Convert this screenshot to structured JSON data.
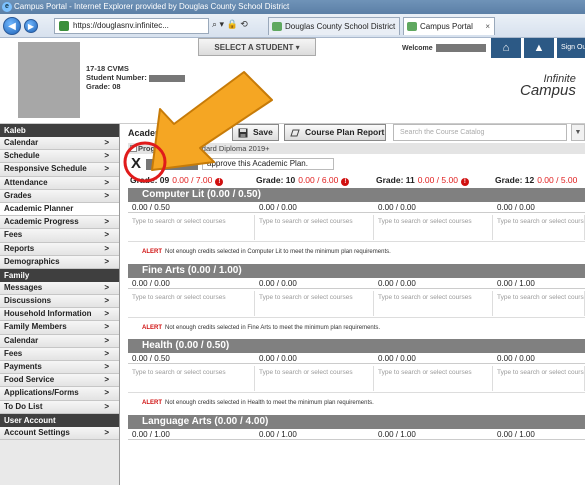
{
  "window": {
    "title": "Campus Portal - Internet Explorer provided by Douglas County School District"
  },
  "browser": {
    "address": "https://douglasnv.infinitec...",
    "address_tools": "⌕ ▾ 🔒 ⟲",
    "tabs": [
      {
        "label": "Douglas County School District"
      },
      {
        "label": "Campus Portal"
      }
    ]
  },
  "header": {
    "select_student": "SELECT A STUDENT  ▾",
    "welcome": "Welcome",
    "signout": "Sign Out",
    "school_year": "17-18 CVMS",
    "student_number_label": "Student Number:",
    "grade_label": "Grade: 08",
    "logo_top": "Infinite",
    "logo_bottom": "Campus"
  },
  "sidebar": {
    "student_name": "Kaleb",
    "student_items": [
      "Calendar",
      "Schedule",
      "Responsive Schedule",
      "Attendance",
      "Grades",
      "Academic Planner",
      "Academic Progress",
      "Fees",
      "Reports",
      "Demographics"
    ],
    "family_header": "Family",
    "family_items": [
      "Messages",
      "Discussions",
      "Household Information",
      "Family Members",
      "Calendar",
      "Fees",
      "Payments",
      "Food Service",
      "Applications/Forms",
      "To Do List"
    ],
    "user_header": "User Account",
    "user_items": [
      "Account Settings"
    ],
    "active": "Academic Planner"
  },
  "toolbar": {
    "title": "Academic Planner",
    "save_label": "Save",
    "report_label": "Course Plan Report",
    "search_placeholder": "Search the Course Catalog"
  },
  "program": {
    "label": "Program:",
    "name": "HS-Standard Diploma 2019+"
  },
  "approval": {
    "mark": "X",
    "text": "approve this Academic Plan."
  },
  "grades": [
    {
      "label": "Grade: 09",
      "credits": "0.00 / 7.00"
    },
    {
      "label": "Grade: 10",
      "credits": "0.00 / 6.00"
    },
    {
      "label": "Grade: 11",
      "credits": "0.00 / 5.00"
    },
    {
      "label": "Grade: 12",
      "credits": "0.00 / 5.00"
    }
  ],
  "course_placeholder": "Type to search or select courses",
  "alert_tag": "ALERT",
  "sections": [
    {
      "title": "Computer Lit (0.00 / 0.50)",
      "credits": [
        "0.00 / 0.50",
        "0.00 / 0.00",
        "0.00 / 0.00",
        "0.00 / 0.00"
      ],
      "alert": "Not enough credits selected in Computer Lit to meet the minimum plan requirements."
    },
    {
      "title": "Fine Arts (0.00 / 1.00)",
      "credits": [
        "0.00 / 0.00",
        "0.00 / 0.00",
        "0.00 / 0.00",
        "0.00 / 1.00"
      ],
      "alert": "Not enough credits selected in Fine Arts to meet the minimum plan requirements."
    },
    {
      "title": "Health (0.00 / 0.50)",
      "credits": [
        "0.00 / 0.50",
        "0.00 / 0.00",
        "0.00 / 0.00",
        "0.00 / 0.00"
      ],
      "alert": "Not enough credits selected in Health to meet the minimum plan requirements."
    },
    {
      "title": "Language Arts (0.00 / 4.00)",
      "credits": [
        "0.00 / 1.00",
        "0.00 / 1.00",
        "0.00 / 1.00",
        "0.00 / 1.00"
      ],
      "alert": ""
    }
  ],
  "colors": {
    "titlebar": "#5b7fa6",
    "nav_blue": "#2c5985",
    "section_header": "#808080",
    "alert_red": "#d01010",
    "credits_red": "#e02020",
    "arrow_orange": "#f5a623",
    "circle_red": "#e01b1b"
  }
}
